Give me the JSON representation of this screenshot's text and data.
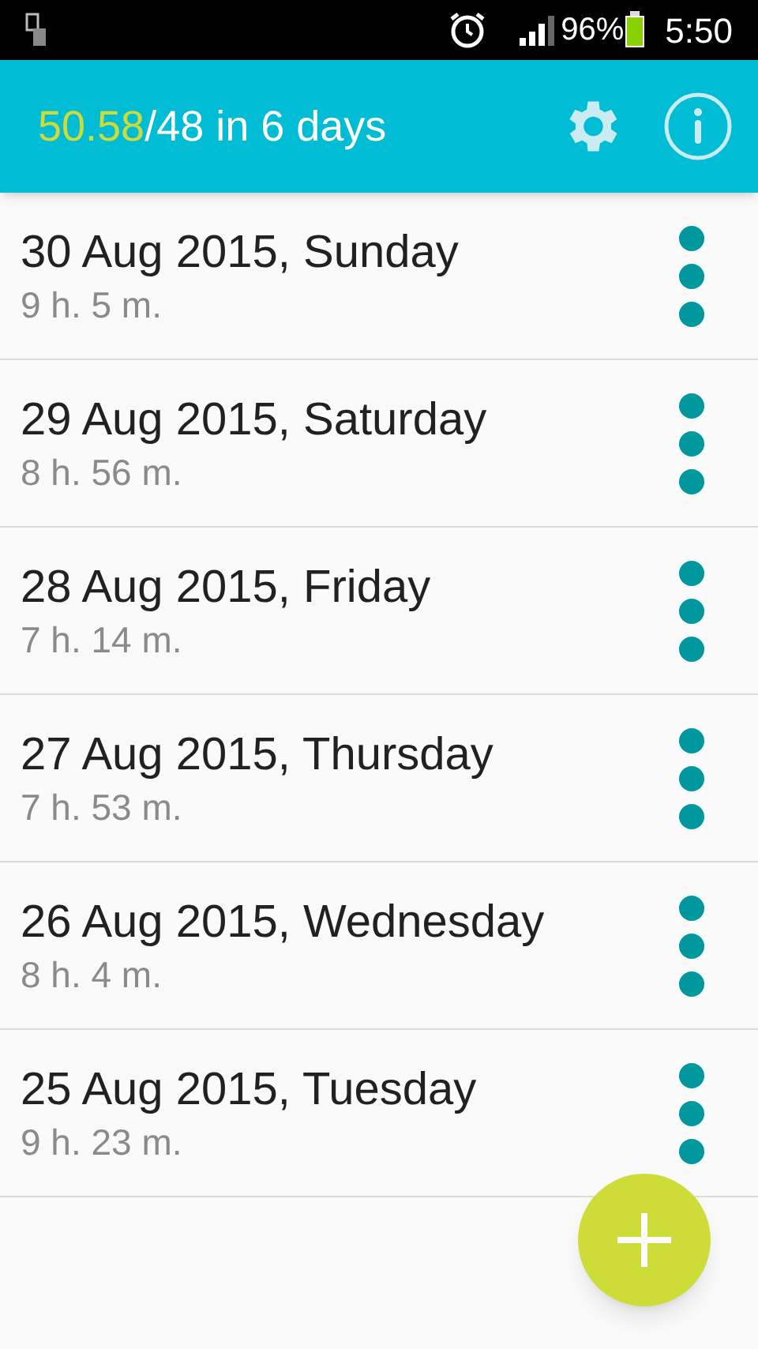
{
  "status_bar": {
    "battery": "96%",
    "time": "5:50"
  },
  "header": {
    "total": "50.58",
    "summary": "/48 in 6 days"
  },
  "days": [
    {
      "date": "30 Aug 2015, Sunday",
      "duration": "9 h. 5 m."
    },
    {
      "date": "29 Aug 2015, Saturday",
      "duration": "8 h. 56 m."
    },
    {
      "date": "28 Aug 2015, Friday",
      "duration": "7 h. 14 m."
    },
    {
      "date": "27 Aug 2015, Thursday",
      "duration": "7 h. 53 m."
    },
    {
      "date": "26 Aug 2015, Wednesday",
      "duration": "8 h. 4 m."
    },
    {
      "date": "25 Aug 2015, Tuesday",
      "duration": "9 h. 23 m."
    }
  ]
}
